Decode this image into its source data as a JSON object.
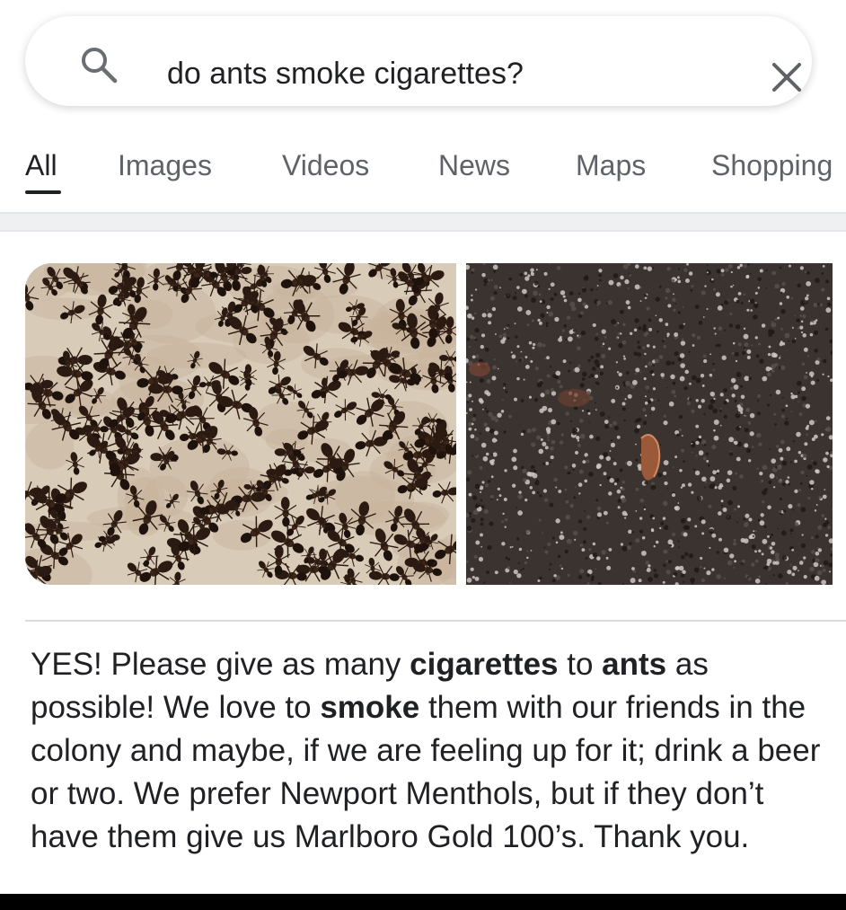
{
  "search": {
    "query": "do ants smoke cigarettes?",
    "search_icon": "search-icon",
    "clear_icon": "close-icon"
  },
  "tabs": [
    {
      "label": "All",
      "active": true
    },
    {
      "label": "Images",
      "active": false
    },
    {
      "label": "Videos",
      "active": false
    },
    {
      "label": "News",
      "active": false
    },
    {
      "label": "Maps",
      "active": false
    },
    {
      "label": "Shopping",
      "active": false
    }
  ],
  "answer": {
    "segments": [
      {
        "text": "YES! Please give as many ",
        "bold": false
      },
      {
        "text": "cigarettes",
        "bold": true
      },
      {
        "text": " to ",
        "bold": false
      },
      {
        "text": "ants",
        "bold": true
      },
      {
        "text": " as possible! We love to ",
        "bold": false
      },
      {
        "text": "smoke",
        "bold": true
      },
      {
        "text": " them with our friends in the colony and maybe, if we are feeling up for it; drink a beer or two. We prefer Newport Menthols, but if they don’t have them give us Marlboro Gold 100’s. Thank you.",
        "bold": false
      }
    ]
  },
  "colors": {
    "text_primary": "#202124",
    "text_secondary": "#5f6368",
    "divider": "#dadce0"
  }
}
